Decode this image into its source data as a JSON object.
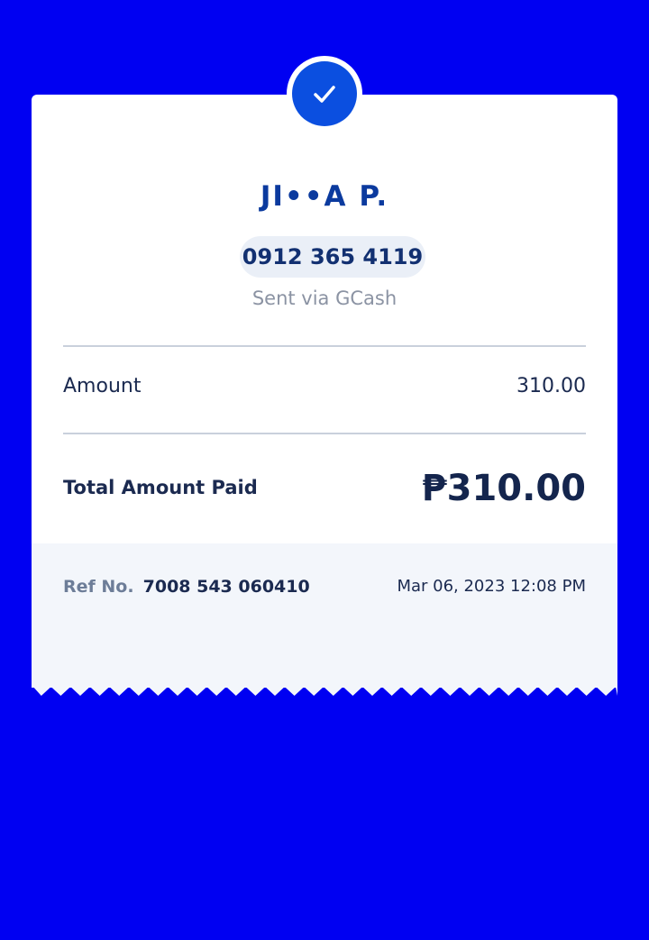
{
  "receipt": {
    "recipient_name": "JI••A P.",
    "phone_number": "0912 365 4119",
    "sent_via": "Sent via GCash",
    "amount_label": "Amount",
    "amount_value": "310.00",
    "total_label": "Total Amount Paid",
    "total_value": "₱310.00",
    "ref_label": "Ref No.",
    "ref_value": "7008 543 060410",
    "datetime": "Mar 06, 2023 12:08 PM"
  },
  "icons": {
    "status": "checkmark-icon"
  },
  "colors": {
    "background": "#0000f2",
    "accent": "#0b4fe0",
    "name_text": "#0b3a9e",
    "dark_text": "#1b2a50",
    "muted_text": "#8b93a3",
    "footer_bg": "#f3f6fb"
  }
}
